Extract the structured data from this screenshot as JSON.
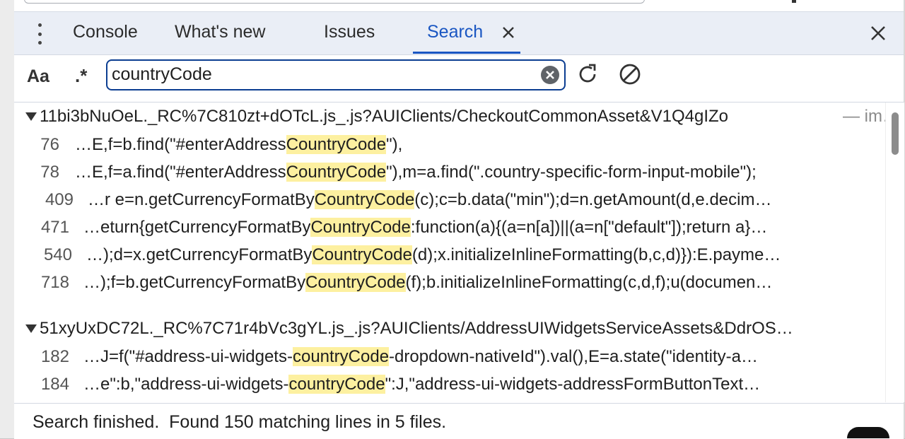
{
  "tabs": [
    {
      "label": "Console"
    },
    {
      "label": "What's new"
    },
    {
      "label": "Issues"
    },
    {
      "label": "Search"
    }
  ],
  "toolbar": {
    "case_label": "Aa",
    "regex_label": ".*",
    "query": "countryCode"
  },
  "results": {
    "files": [
      {
        "name": "11bi3bNuOeL._RC%7C810zt+dOTcL.js_.js?AUIClients/CheckoutCommonAsset&V1Q4gIZo",
        "suffix": "— im…",
        "matches": [
          {
            "line": "76",
            "pre": "…E,f=b.find(\"#enterAddress",
            "hit": "CountryCode",
            "post": "\"),"
          },
          {
            "line": "78",
            "pre": "…E,f=a.find(\"#enterAddress",
            "hit": "CountryCode",
            "post": "\"),m=a.find(\".country-specific-form-input-mobile\");"
          },
          {
            "line": "409",
            "pre": "…r e=n.getCurrencyFormatBy",
            "hit": "CountryCode",
            "post": "(c);c=b.data(\"min\");d=n.getAmount(d,e.decim…"
          },
          {
            "line": "471",
            "pre": "…eturn{getCurrencyFormatBy",
            "hit": "CountryCode",
            "post": ":function(a){(a=n[a])||(a=n[\"default\"]);return a}…"
          },
          {
            "line": "540",
            "pre": "…);d=x.getCurrencyFormatBy",
            "hit": "CountryCode",
            "post": "(d);x.initializeInlineFormatting(b,c,d)}):E.payme…"
          },
          {
            "line": "718",
            "pre": "…);f=b.getCurrencyFormatBy",
            "hit": "CountryCode",
            "post": "(f);b.initializeInlineFormatting(c,d,f);u(documen…"
          }
        ]
      },
      {
        "name": "51xyUxDC72L._RC%7C71r4bVc3gYL.js_.js?AUIClients/AddressUIWidgetsServiceAssets&DdrOS…",
        "suffix": "",
        "matches": [
          {
            "line": "182",
            "pre": "…J=f(\"#address-ui-widgets-",
            "hit": "countryCode",
            "post": "-dropdown-nativeId\").val(),E=a.state(\"identity-a…"
          },
          {
            "line": "184",
            "pre": "…e\":b,\"address-ui-widgets-",
            "hit": "countryCode",
            "post": "\":J,\"address-ui-widgets-addressFormButtonText…"
          }
        ]
      }
    ]
  },
  "status": {
    "text": "Search finished.  Found 150 matching lines in 5 files."
  },
  "colors": {
    "accent": "#1a56c2",
    "highlight": "#fdf0a0",
    "tabbar_bg": "#eaeef6"
  },
  "icons": [
    "kebab-menu-icon",
    "close-icon",
    "clear-icon",
    "refresh-icon",
    "cancel-icon",
    "expand-triangle-icon"
  ]
}
